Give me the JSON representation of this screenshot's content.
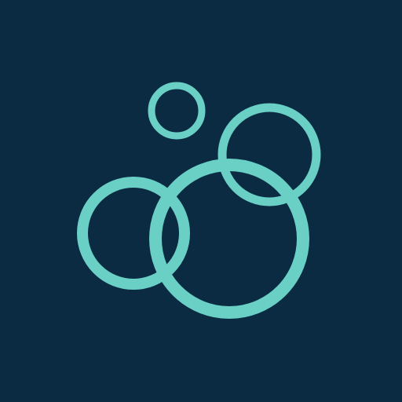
{
  "app_icon": {
    "icon_name": "bubbles-icon",
    "background_color": "#0a2b42",
    "accent_color": "#6ad0c6",
    "bubble_count": 4
  }
}
